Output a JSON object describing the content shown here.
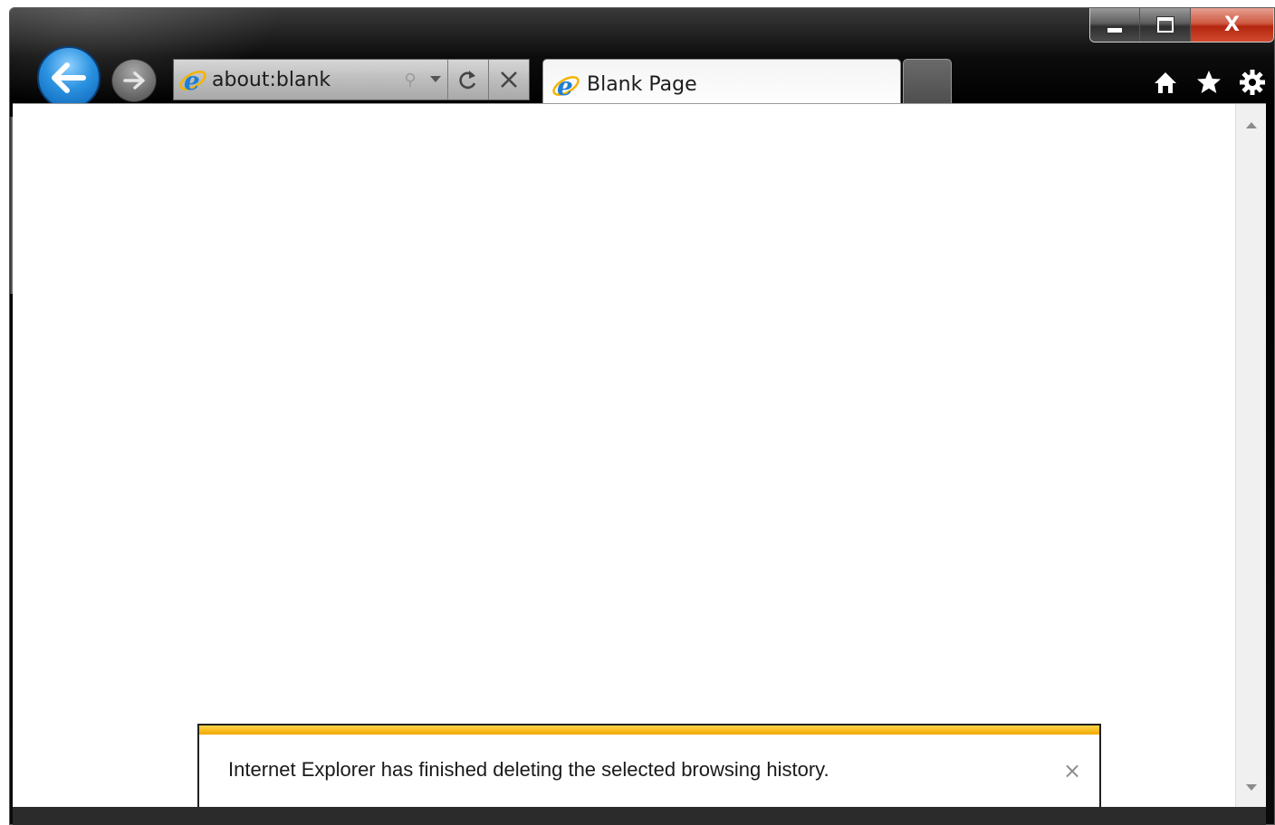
{
  "window": {
    "caption_buttons": {
      "minimize_icon": "minimize-icon",
      "maximize_icon": "maximize-icon",
      "close_label": "X"
    }
  },
  "navigation": {
    "back_icon": "back-arrow-icon",
    "forward_icon": "forward-arrow-icon"
  },
  "address_bar": {
    "url": "about:blank",
    "icon": "ie-logo-icon",
    "search_icon": "search-icon",
    "dropdown_icon": "chevron-down-icon",
    "refresh_icon": "refresh-icon",
    "stop_icon": "stop-icon"
  },
  "tabs": [
    {
      "title": "Blank Page",
      "icon": "ie-logo-icon",
      "active": true
    }
  ],
  "toolbar": {
    "home_icon": "home-icon",
    "favorites_icon": "star-icon",
    "tools_icon": "gear-icon"
  },
  "notification": {
    "message": "Internet Explorer has finished deleting the selected browsing history.",
    "close_glyph": "×",
    "accent_color": "#f0a800"
  },
  "colors": {
    "frame": "#000000",
    "back_button": "#2a92e0",
    "close_button": "#c9432a"
  }
}
